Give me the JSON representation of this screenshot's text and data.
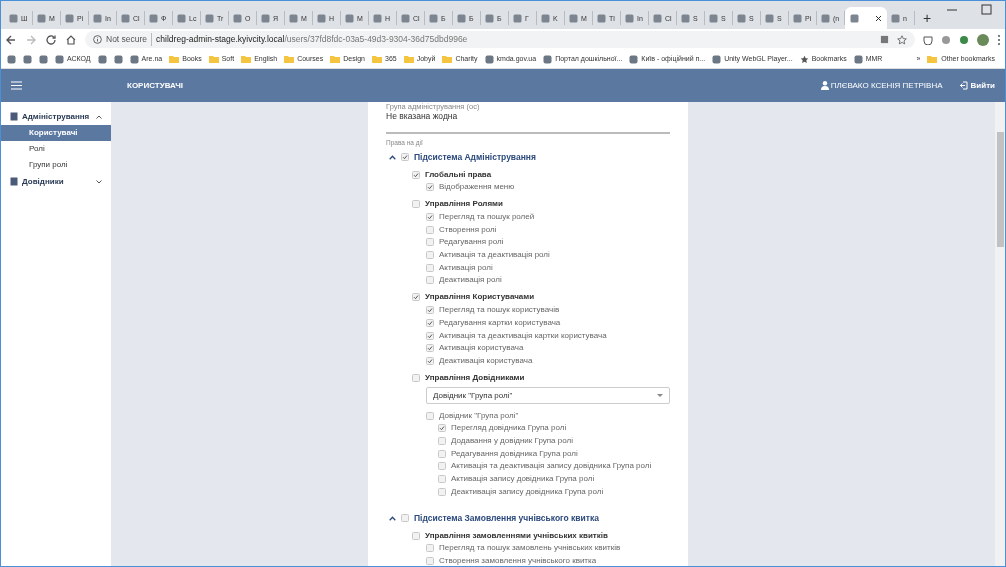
{
  "browser": {
    "tabs": [
      {
        "label": "Ш",
        "selected": false
      },
      {
        "label": "M",
        "selected": false
      },
      {
        "label": "Pi",
        "selected": false
      },
      {
        "label": "In",
        "selected": false
      },
      {
        "label": "Cl",
        "selected": false
      },
      {
        "label": "Ф",
        "selected": false
      },
      {
        "label": "Lc",
        "selected": false
      },
      {
        "label": "Tr",
        "selected": false
      },
      {
        "label": "O",
        "selected": false
      },
      {
        "label": "Я",
        "selected": false
      },
      {
        "label": "M",
        "selected": false
      },
      {
        "label": "H",
        "selected": false
      },
      {
        "label": "M",
        "selected": false
      },
      {
        "label": "H",
        "selected": false
      },
      {
        "label": "Cl",
        "selected": false
      },
      {
        "label": "Б",
        "selected": false
      },
      {
        "label": "Б",
        "selected": false
      },
      {
        "label": "Б",
        "selected": false
      },
      {
        "label": "Г",
        "selected": false
      },
      {
        "label": "K",
        "selected": false
      },
      {
        "label": "M",
        "selected": false
      },
      {
        "label": "Tl",
        "selected": false
      },
      {
        "label": "In",
        "selected": false
      },
      {
        "label": "Cl",
        "selected": false
      },
      {
        "label": "S",
        "selected": false
      },
      {
        "label": "S",
        "selected": false
      },
      {
        "label": "S",
        "selected": false
      },
      {
        "label": "S",
        "selected": false
      },
      {
        "label": "Pi",
        "selected": false
      },
      {
        "label": "(n",
        "selected": false
      },
      {
        "selected": true
      },
      {
        "label": "n",
        "selected": false
      }
    ],
    "new_tab": "+",
    "address": {
      "security": "Not secure",
      "host": "childreg-admin-stage.kyivcity.local",
      "path": "/users/37fd8fdc-03a5-49d3-9304-36d75dbd996e"
    },
    "bookmarks": [
      {
        "kind": "site"
      },
      {
        "kind": "site"
      },
      {
        "kind": "site"
      },
      {
        "label": "АСКОД",
        "kind": "site"
      },
      {
        "kind": "site"
      },
      {
        "kind": "site"
      },
      {
        "label": "Are.na",
        "kind": "site"
      },
      {
        "label": "Books",
        "kind": "folder"
      },
      {
        "label": "Soft",
        "kind": "folder"
      },
      {
        "label": "English",
        "kind": "folder"
      },
      {
        "label": "Courses",
        "kind": "folder"
      },
      {
        "label": "Design",
        "kind": "folder"
      },
      {
        "label": "365",
        "kind": "folder"
      },
      {
        "label": "Jobyй",
        "kind": "folder"
      },
      {
        "label": "Charity",
        "kind": "folder"
      },
      {
        "label": "kmda.gov.ua",
        "kind": "site"
      },
      {
        "label": "Портал дошкільної...",
        "kind": "site"
      },
      {
        "label": "Київ - офіційний п...",
        "kind": "site"
      },
      {
        "label": "Unity WebGL Player...",
        "kind": "site"
      },
      {
        "label": "Bookmarks",
        "kind": "star"
      },
      {
        "label": "MMR",
        "kind": "site"
      }
    ],
    "more": "»",
    "other_bookmarks": "Other bookmarks"
  },
  "header": {
    "title": "КОРИСТУВАЧІ",
    "user": "ПЛЄВАКО КСЕНІЯ ПЕТРІВНА",
    "logout": "Вийти"
  },
  "sidebar": {
    "sections": [
      {
        "label": "Адміністрування",
        "expanded": true,
        "items": [
          {
            "label": "Користувачі",
            "selected": true
          },
          {
            "label": "Ролі",
            "selected": false
          },
          {
            "label": "Групи ролі",
            "selected": false
          }
        ]
      },
      {
        "label": "Довідники",
        "expanded": false
      }
    ]
  },
  "form": {
    "group_label": "Група адміністрування (ос)",
    "group_value": "Не вказана жодна",
    "rights_label": "Права на дії",
    "permissions": [
      {
        "label": "Підсистема Адміністрування",
        "checked": true,
        "expanded": true,
        "children": [
          {
            "label": "Глобальні права",
            "checked": true,
            "children": [
              {
                "label": "Відображення меню",
                "checked": true
              }
            ]
          },
          {
            "label": "Управління Ролями",
            "checked": false,
            "children": [
              {
                "label": "Перегляд та пошук ролей",
                "checked": true
              },
              {
                "label": "Створення ролі",
                "checked": false
              },
              {
                "label": "Редагування ролі",
                "checked": false
              },
              {
                "label": "Активація та деактивація ролі",
                "checked": false
              },
              {
                "label": "Активація ролі",
                "checked": false
              },
              {
                "label": "Деактивація ролі",
                "checked": false
              }
            ]
          },
          {
            "label": "Управління Користувачами",
            "checked": true,
            "children": [
              {
                "label": "Перегляд та пошук користувачів",
                "checked": true
              },
              {
                "label": "Редагування картки користувача",
                "checked": true
              },
              {
                "label": "Активація та деактивація картки користувача",
                "checked": true
              },
              {
                "label": "Активація користувача",
                "checked": true
              },
              {
                "label": "Деактивація користувача",
                "checked": true
              }
            ]
          },
          {
            "label": "Управління Довідниками",
            "checked": false,
            "select": {
              "value": "Довідник \"Група ролі\""
            },
            "children": [
              {
                "label": "Довідник \"Група ролі\"",
                "checked": false,
                "children": [
                  {
                    "label": "Перегляд довідника Група ролі",
                    "checked": true
                  },
                  {
                    "label": "Додавання у довідник Група ролі",
                    "checked": false
                  },
                  {
                    "label": "Редагування довідника Група ролі",
                    "checked": false
                  },
                  {
                    "label": "Активація та деактивація запису довідника Група ролі",
                    "checked": false
                  },
                  {
                    "label": "Активація запису довідника Група ролі",
                    "checked": false
                  },
                  {
                    "label": "Деактивація запису довідника Група ролі",
                    "checked": false
                  }
                ]
              }
            ]
          }
        ]
      },
      {
        "label": "Підсистема Замовлення учнівського квитка",
        "checked": false,
        "expanded": true,
        "children": [
          {
            "label": "Управління замовленнями учнівських квитків",
            "checked": false,
            "children": [
              {
                "label": "Перегляд та пошук замовлень учнівських квитків",
                "checked": false
              },
              {
                "label": "Створення замовлення учнівського квитка",
                "checked": false
              }
            ]
          }
        ]
      }
    ]
  }
}
